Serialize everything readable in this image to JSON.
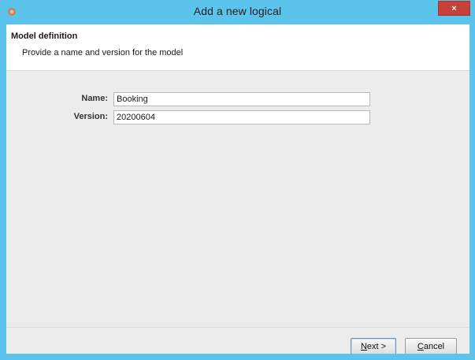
{
  "window": {
    "title": "Add a new logical",
    "close_label": "×"
  },
  "header": {
    "title": "Model definition",
    "subtitle": "Provide a name and version for the model"
  },
  "form": {
    "name_label": "Name:",
    "name_value": "Booking",
    "version_label": "Version:",
    "version_value": "20200604"
  },
  "buttons": {
    "next_mnemonic": "N",
    "next_rest": "ext >",
    "cancel_mnemonic": "C",
    "cancel_rest": "ancel"
  },
  "colors": {
    "titlebar": "#5bc3ec",
    "close": "#c7403a",
    "panel": "#ececec"
  },
  "icons": {
    "app": "java-coffee-icon",
    "close": "close-icon"
  }
}
